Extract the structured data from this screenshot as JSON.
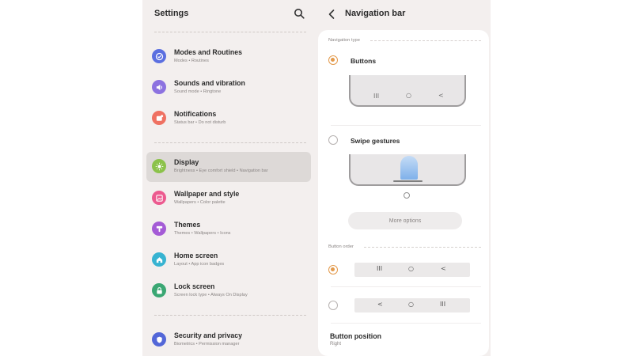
{
  "colors": {
    "accent": "#e39a4c",
    "panel_bg": "#f3efee",
    "active_item_bg": "#ddd9d7"
  },
  "left": {
    "title": "Settings",
    "search_icon": "search-icon",
    "items": [
      {
        "title": "Modes and Routines",
        "subtitle": "Modes • Routines",
        "icon": "check-circle-icon",
        "icon_color": "#5b6fe0"
      },
      {
        "title": "Sounds and vibration",
        "subtitle": "Sound mode • Ringtone",
        "icon": "speaker-icon",
        "icon_color": "#8c72e0"
      },
      {
        "title": "Notifications",
        "subtitle": "Status bar • Do not disturb",
        "icon": "notification-icon",
        "icon_color": "#ef7162"
      },
      {
        "title": "Display",
        "subtitle": "Brightness • Eye comfort shield • Navigation bar",
        "icon": "sun-icon",
        "icon_color": "#8bc24a"
      },
      {
        "title": "Wallpaper and style",
        "subtitle": "Wallpapers • Color palette",
        "icon": "wallpaper-icon",
        "icon_color": "#ec5a8f"
      },
      {
        "title": "Themes",
        "subtitle": "Themes • Wallpapers • Icons",
        "icon": "themes-icon",
        "icon_color": "#a45bd6"
      },
      {
        "title": "Home screen",
        "subtitle": "Layout • App icon badges",
        "icon": "home-icon",
        "icon_color": "#37b3d1"
      },
      {
        "title": "Lock screen",
        "subtitle": "Screen lock type • Always On Display",
        "icon": "lock-icon",
        "icon_color": "#3aa773"
      },
      {
        "title": "Security and privacy",
        "subtitle": "Biometrics • Permission manager",
        "icon": "shield-icon",
        "icon_color": "#5367d8"
      }
    ]
  },
  "right": {
    "title": "Navigation bar",
    "back_icon": "back-arrow-icon",
    "navigation_type_label": "Navigation type",
    "buttons_label": "Buttons",
    "swipe_label": "Swipe gestures",
    "buttons_selected": true,
    "swipe_selected": false,
    "preview_buttons": [
      "III",
      "○",
      "<"
    ],
    "more_options": "More options",
    "button_order_label": "Button order",
    "order_options": [
      {
        "selected": true,
        "glyphs": [
          "III",
          "○",
          "<"
        ]
      },
      {
        "selected": false,
        "glyphs": [
          "<",
          "○",
          "III"
        ]
      }
    ],
    "button_position_title": "Button position",
    "button_position_value": "Right"
  }
}
